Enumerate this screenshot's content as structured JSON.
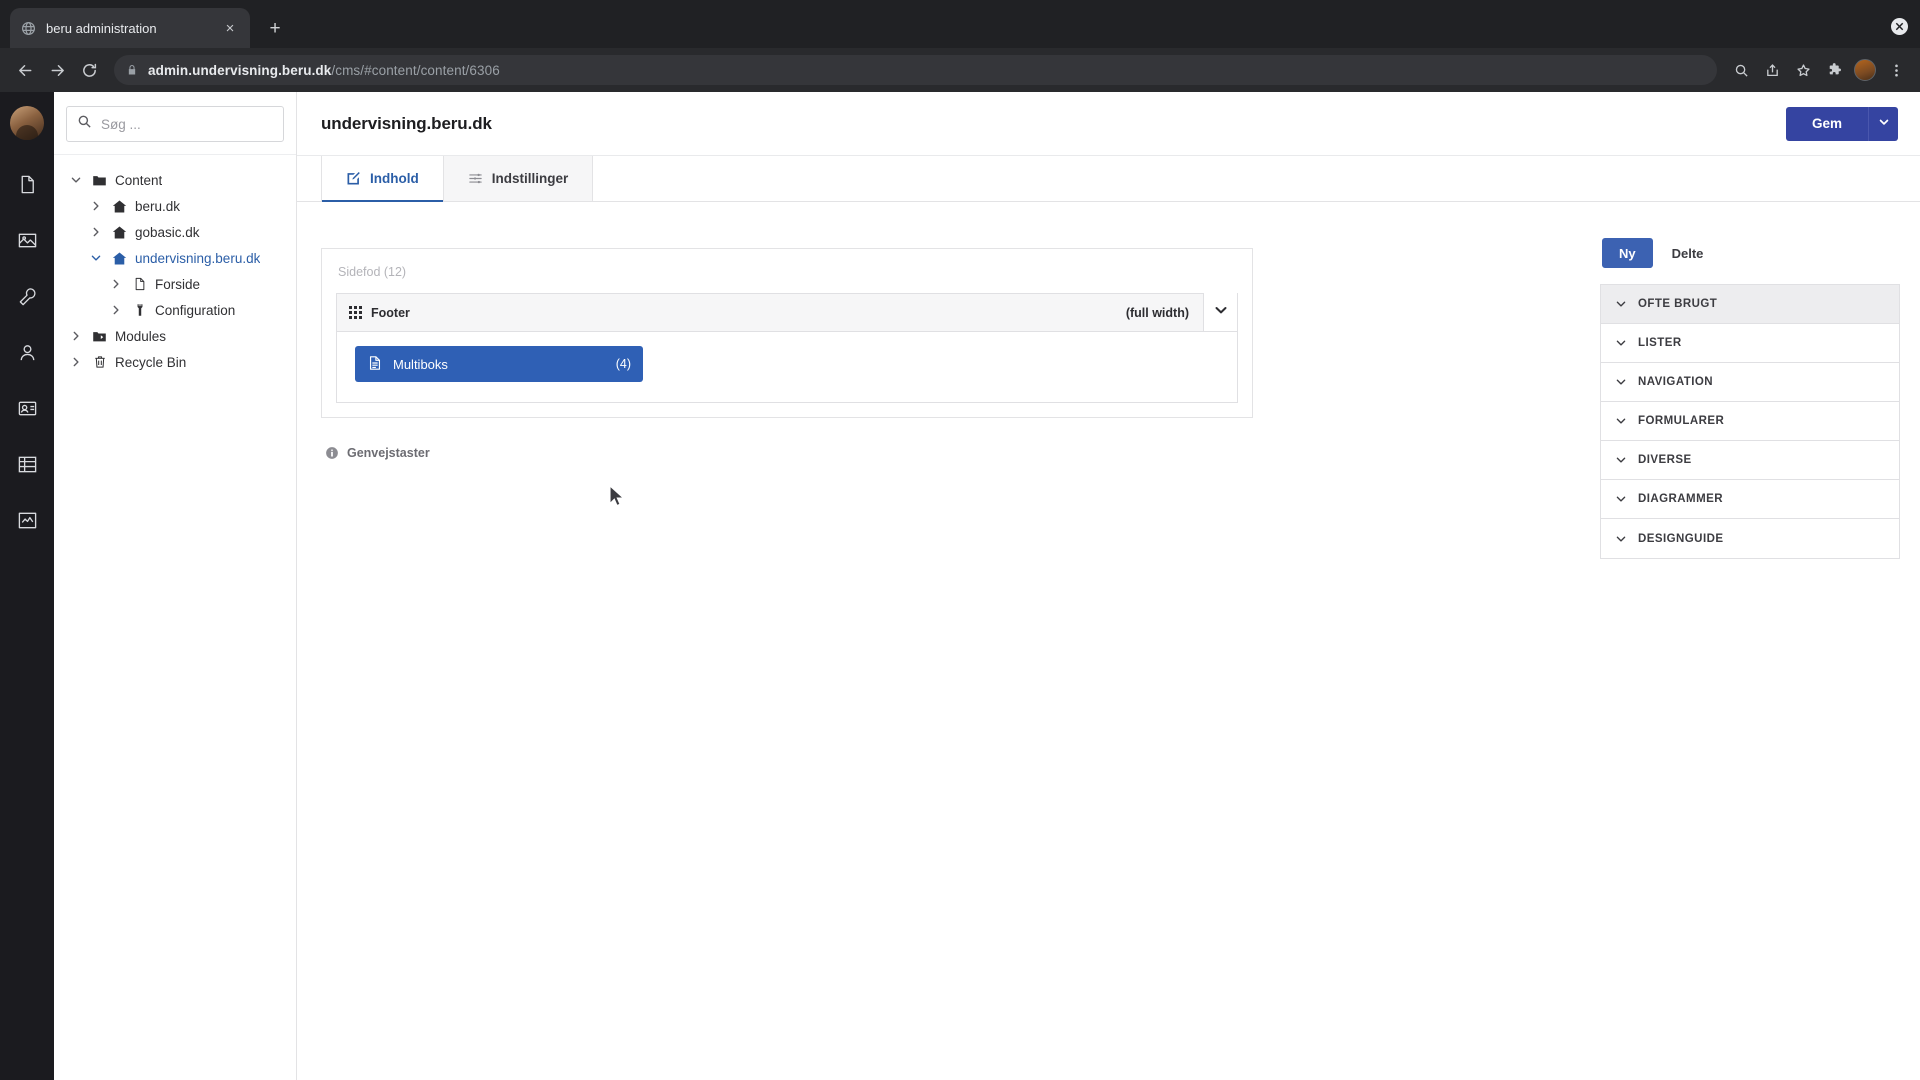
{
  "browser": {
    "tab": {
      "title": "beru administration",
      "favicon": "globe-icon",
      "close": "×"
    },
    "new_tab_label": "+",
    "url_host": "admin.undervisning.beru.dk",
    "url_path": "/cms/#content/content/6306",
    "nav": {
      "back": "←",
      "forward": "→",
      "reload": "⟳"
    },
    "omni_icons": [
      "zoom-icon",
      "share-icon",
      "bookmark-icon",
      "extensions-icon",
      "profile-icon",
      "menu-icon"
    ]
  },
  "rail": {
    "items": [
      {
        "name": "content-icon"
      },
      {
        "name": "media-icon"
      },
      {
        "name": "settings-wrench-icon"
      },
      {
        "name": "users-icon"
      },
      {
        "name": "members-icon"
      },
      {
        "name": "forms-icon"
      },
      {
        "name": "analytics-icon"
      }
    ]
  },
  "sidebar": {
    "search": {
      "placeholder": "Søg ...",
      "value": ""
    },
    "tree": [
      {
        "label": "Content",
        "icon": "folder-icon",
        "depth": 0,
        "expanded": true,
        "selected": false
      },
      {
        "label": "beru.dk",
        "icon": "home-icon",
        "depth": 1,
        "expanded": false,
        "selected": false
      },
      {
        "label": "gobasic.dk",
        "icon": "home-icon",
        "depth": 1,
        "expanded": false,
        "selected": false
      },
      {
        "label": "undervisning.beru.dk",
        "icon": "home-icon",
        "depth": 1,
        "expanded": true,
        "selected": true
      },
      {
        "label": "Forside",
        "icon": "document-icon",
        "depth": 2,
        "expanded": false,
        "selected": false
      },
      {
        "label": "Configuration",
        "icon": "wrench-icon",
        "depth": 2,
        "expanded": false,
        "selected": false
      },
      {
        "label": "Modules",
        "icon": "modules-folder-icon",
        "depth": 0,
        "expanded": false,
        "selected": false
      },
      {
        "label": "Recycle Bin",
        "icon": "trash-icon",
        "depth": 0,
        "expanded": false,
        "selected": false
      }
    ]
  },
  "header": {
    "title": "undervisning.beru.dk",
    "save_label": "Gem",
    "save_caret": "chevron-down-icon"
  },
  "tabs": [
    {
      "label": "Indhold",
      "icon": "edit-pencil-icon",
      "active": true
    },
    {
      "label": "Indstillinger",
      "icon": "sliders-icon",
      "active": false
    }
  ],
  "canvas": {
    "grid_title": "Sidefod (12)",
    "block": {
      "name": "Footer",
      "icon": "grid-dots-icon",
      "width_label": "(full width)",
      "caret": "chevron-down-icon"
    },
    "widgets": [
      {
        "label": "Multiboks",
        "count": "(4)",
        "icon": "document-icon"
      }
    ],
    "shortcuts_label": "Genvejstaster",
    "shortcuts_icon": "info-icon"
  },
  "right_panel": {
    "toggles": [
      {
        "label": "Ny",
        "active": true
      },
      {
        "label": "Delte",
        "active": false
      }
    ],
    "groups": [
      {
        "label": "OFTE BRUGT",
        "expanded": true,
        "shaded": true
      },
      {
        "label": "LISTER",
        "expanded": false,
        "shaded": false
      },
      {
        "label": "NAVIGATION",
        "expanded": false,
        "shaded": false
      },
      {
        "label": "FORMULARER",
        "expanded": false,
        "shaded": false
      },
      {
        "label": "DIVERSE",
        "expanded": false,
        "shaded": false
      },
      {
        "label": "DIAGRAMMER",
        "expanded": false,
        "shaded": false
      },
      {
        "label": "DESIGNGUIDE",
        "expanded": false,
        "shaded": false
      }
    ]
  },
  "colors": {
    "accent_blue": "#2b5ea7",
    "save_blue": "#3544a1",
    "widget_blue": "#2f60b5",
    "toggle_blue": "#3c62b2",
    "chrome_dark": "#202124"
  }
}
